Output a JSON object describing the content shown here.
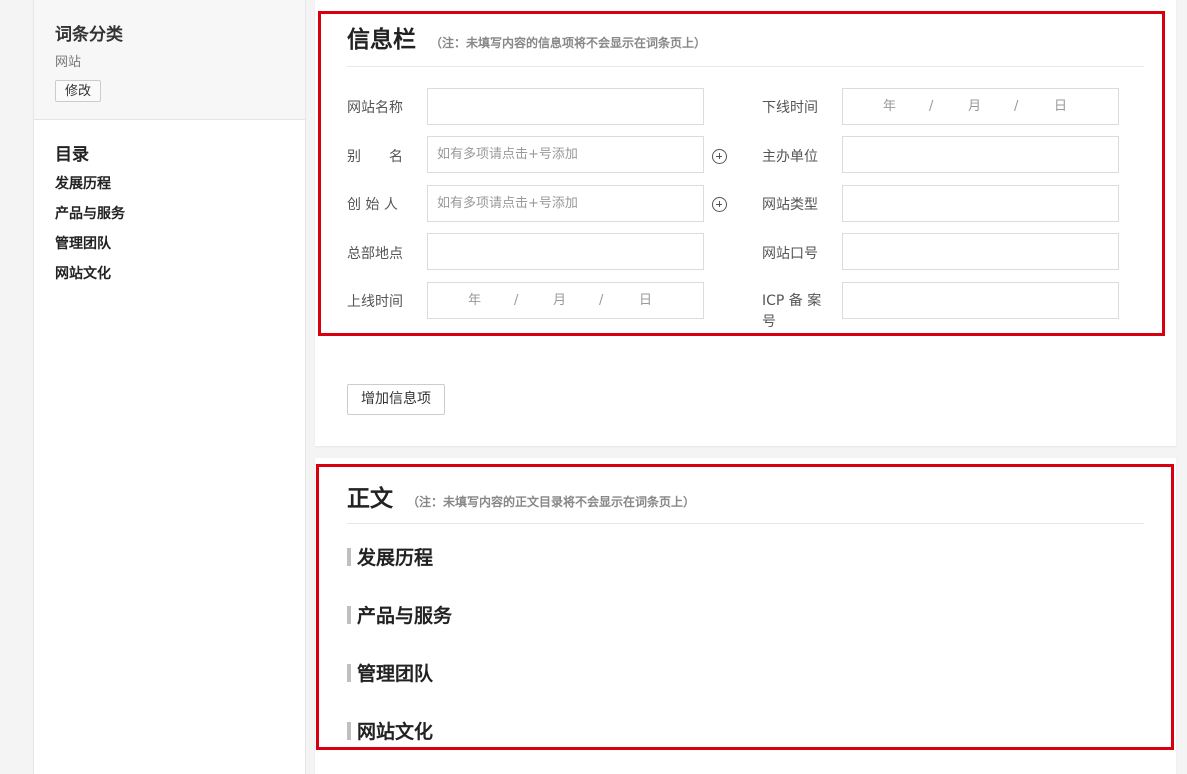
{
  "sidebar": {
    "category": {
      "title": "词条分类",
      "value": "网站",
      "edit_label": "修改"
    },
    "toc": {
      "title": "目录",
      "items": [
        "发展历程",
        "产品与服务",
        "管理团队",
        "网站文化"
      ]
    }
  },
  "info_section": {
    "title": "信息栏",
    "note": "（注：未填写内容的信息项将不会显示在词条页上）",
    "left_fields": [
      {
        "label": "网站名称",
        "value": ""
      },
      {
        "label": "别　　名",
        "placeholder": "如有多项请点击+号添加"
      },
      {
        "label": "创 始 人",
        "placeholder": "如有多项请点击+号添加"
      },
      {
        "label": "总部地点",
        "value": ""
      },
      {
        "label": "上线时间",
        "date": [
          "年",
          "/",
          "月",
          "/",
          "日"
        ]
      }
    ],
    "right_fields": [
      {
        "label": "下线时间",
        "date": [
          "年",
          "/",
          "月",
          "/",
          "日"
        ]
      },
      {
        "label": "主办单位",
        "value": ""
      },
      {
        "label": "网站类型",
        "value": ""
      },
      {
        "label": "网站口号",
        "value": ""
      },
      {
        "label": "ICP 备 案 号",
        "value": ""
      }
    ],
    "add_button": "增加信息项"
  },
  "body_section": {
    "title": "正文",
    "note": "（注：未填写内容的正文目录将不会显示在词条页上）",
    "items": [
      "发展历程",
      "产品与服务",
      "管理团队",
      "网站文化"
    ]
  },
  "colors": {
    "highlight": "#d7000f",
    "page_bg": "#f4f4f4",
    "card_bg": "#ffffff"
  },
  "icons": {
    "add": "plus-circle-icon"
  }
}
